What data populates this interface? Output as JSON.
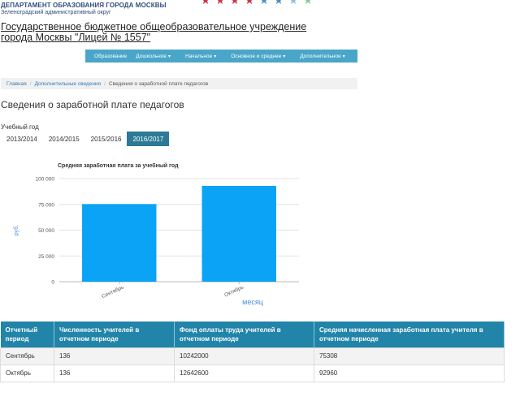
{
  "header": {
    "department": "ДЕПАРТАМЕНТ ОБРАЗОВАНИЯ ГОРОДА МОСКВЫ",
    "district": "Зеленоградский административный округ",
    "stars": [
      "#d2334a",
      "#d2334a",
      "#d2334a",
      "#d2334a",
      "#4a90c4",
      "#4a90c4",
      "#8fc0e0",
      "#7fcf9f"
    ],
    "school_name": "Государственное бюджетное общеобразовательное учреждение города Москвы \"Лицей № 1557\""
  },
  "nav": {
    "items": [
      {
        "label": "Образование"
      },
      {
        "label": "Дошкольное",
        "dropdown": true
      },
      {
        "label": "Начальное",
        "dropdown": true
      },
      {
        "label": "Основное и среднее",
        "dropdown": true
      },
      {
        "label": "Дополнительное",
        "dropdown": true
      }
    ]
  },
  "breadcrumb": {
    "items": [
      "Главная",
      "Дополнительные сведения"
    ],
    "current": "Сведения о заработной плате педагогов"
  },
  "page_title": "Сведения о заработной плате педагогов",
  "year_selector": {
    "label": "Учебный год",
    "tabs": [
      "2013/2014",
      "2014/2015",
      "2015/2016",
      "2016/2017"
    ],
    "active": "2016/2017"
  },
  "chart_data": {
    "type": "bar",
    "title": "Средняя заработная плата за учебный год",
    "categories": [
      "Сентябрь",
      "Октябрь"
    ],
    "values": [
      75308,
      92960
    ],
    "xlabel": "месяц",
    "ylabel": "руб.",
    "ylim": [
      0,
      100000
    ],
    "yticks": [
      0,
      25000,
      50000,
      75000,
      100000
    ],
    "ytick_labels": [
      "0",
      "25 000",
      "50 000",
      "75 000",
      "100 000"
    ],
    "grid": true,
    "bar_color": "#0aa3f5"
  },
  "table": {
    "headers": [
      "Отчетный период",
      "Численность учителей в отчетном периоде",
      "Фонд оплаты труда учителей в отчетном периоде",
      "Средняя начисленная заработная плата учителя в отчетном периоде"
    ],
    "rows": [
      [
        "Сентябрь",
        "136",
        "10242000",
        "75308"
      ],
      [
        "Октябрь",
        "136",
        "12642600",
        "92960"
      ]
    ]
  }
}
